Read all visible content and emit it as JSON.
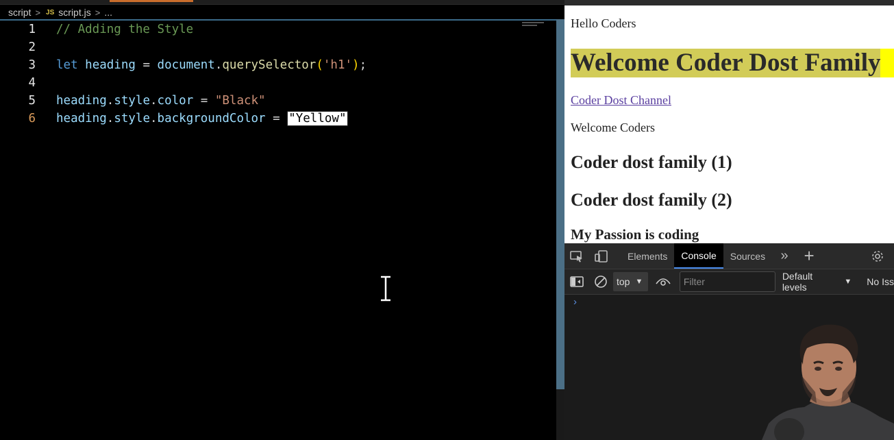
{
  "editor": {
    "breadcrumb": {
      "folder": "script",
      "file_icon": "JS",
      "file": "script.js",
      "trail": "..."
    },
    "lines": [
      {
        "num": "1",
        "text": "// Adding the Style"
      },
      {
        "num": "2",
        "text": ""
      },
      {
        "num": "3",
        "kw": "let",
        "var": "heading",
        "eq": " = ",
        "obj": "document",
        "dot": ".",
        "fn": "querySelector",
        "open": "(",
        "arg": "'h1'",
        "close": ")",
        "end": ";"
      },
      {
        "num": "4",
        "text": ""
      },
      {
        "num": "5",
        "obj": "heading",
        "d1": ".",
        "p1": "style",
        "d2": ".",
        "p2": "color",
        "eq": " = ",
        "val": "\"Black\""
      },
      {
        "num": "6",
        "obj": "heading",
        "d1": ".",
        "p1": "style",
        "d2": ".",
        "p2": "backgroundColor",
        "eq": " = ",
        "val": "\"Yellow\""
      }
    ],
    "colors": {
      "comment": "#6a9955",
      "keyword": "#569cd6",
      "variable": "#9cdcfe",
      "function": "#dcdcaa",
      "string": "#ce9178"
    }
  },
  "browser": {
    "paragraph_1": "Hello Coders",
    "heading_1": "Welcome Coder Dost Family",
    "link": "Coder Dost Channel",
    "paragraph_2": "Welcome Coders",
    "heading_2a": "Coder dost family (1)",
    "heading_2b": "Coder dost family (2)",
    "heading_3": "My Passion is coding",
    "heading_bg": "#d2cc58",
    "heading_bg_overflow": "#ffff00"
  },
  "devtools": {
    "tabs": [
      "Elements",
      "Console",
      "Sources"
    ],
    "active_tab": "Console",
    "context": "top",
    "filter_placeholder": "Filter",
    "levels": "Default levels",
    "issues": "No Iss",
    "prompt_symbol": "›",
    "accent": "#4a8ef0"
  }
}
